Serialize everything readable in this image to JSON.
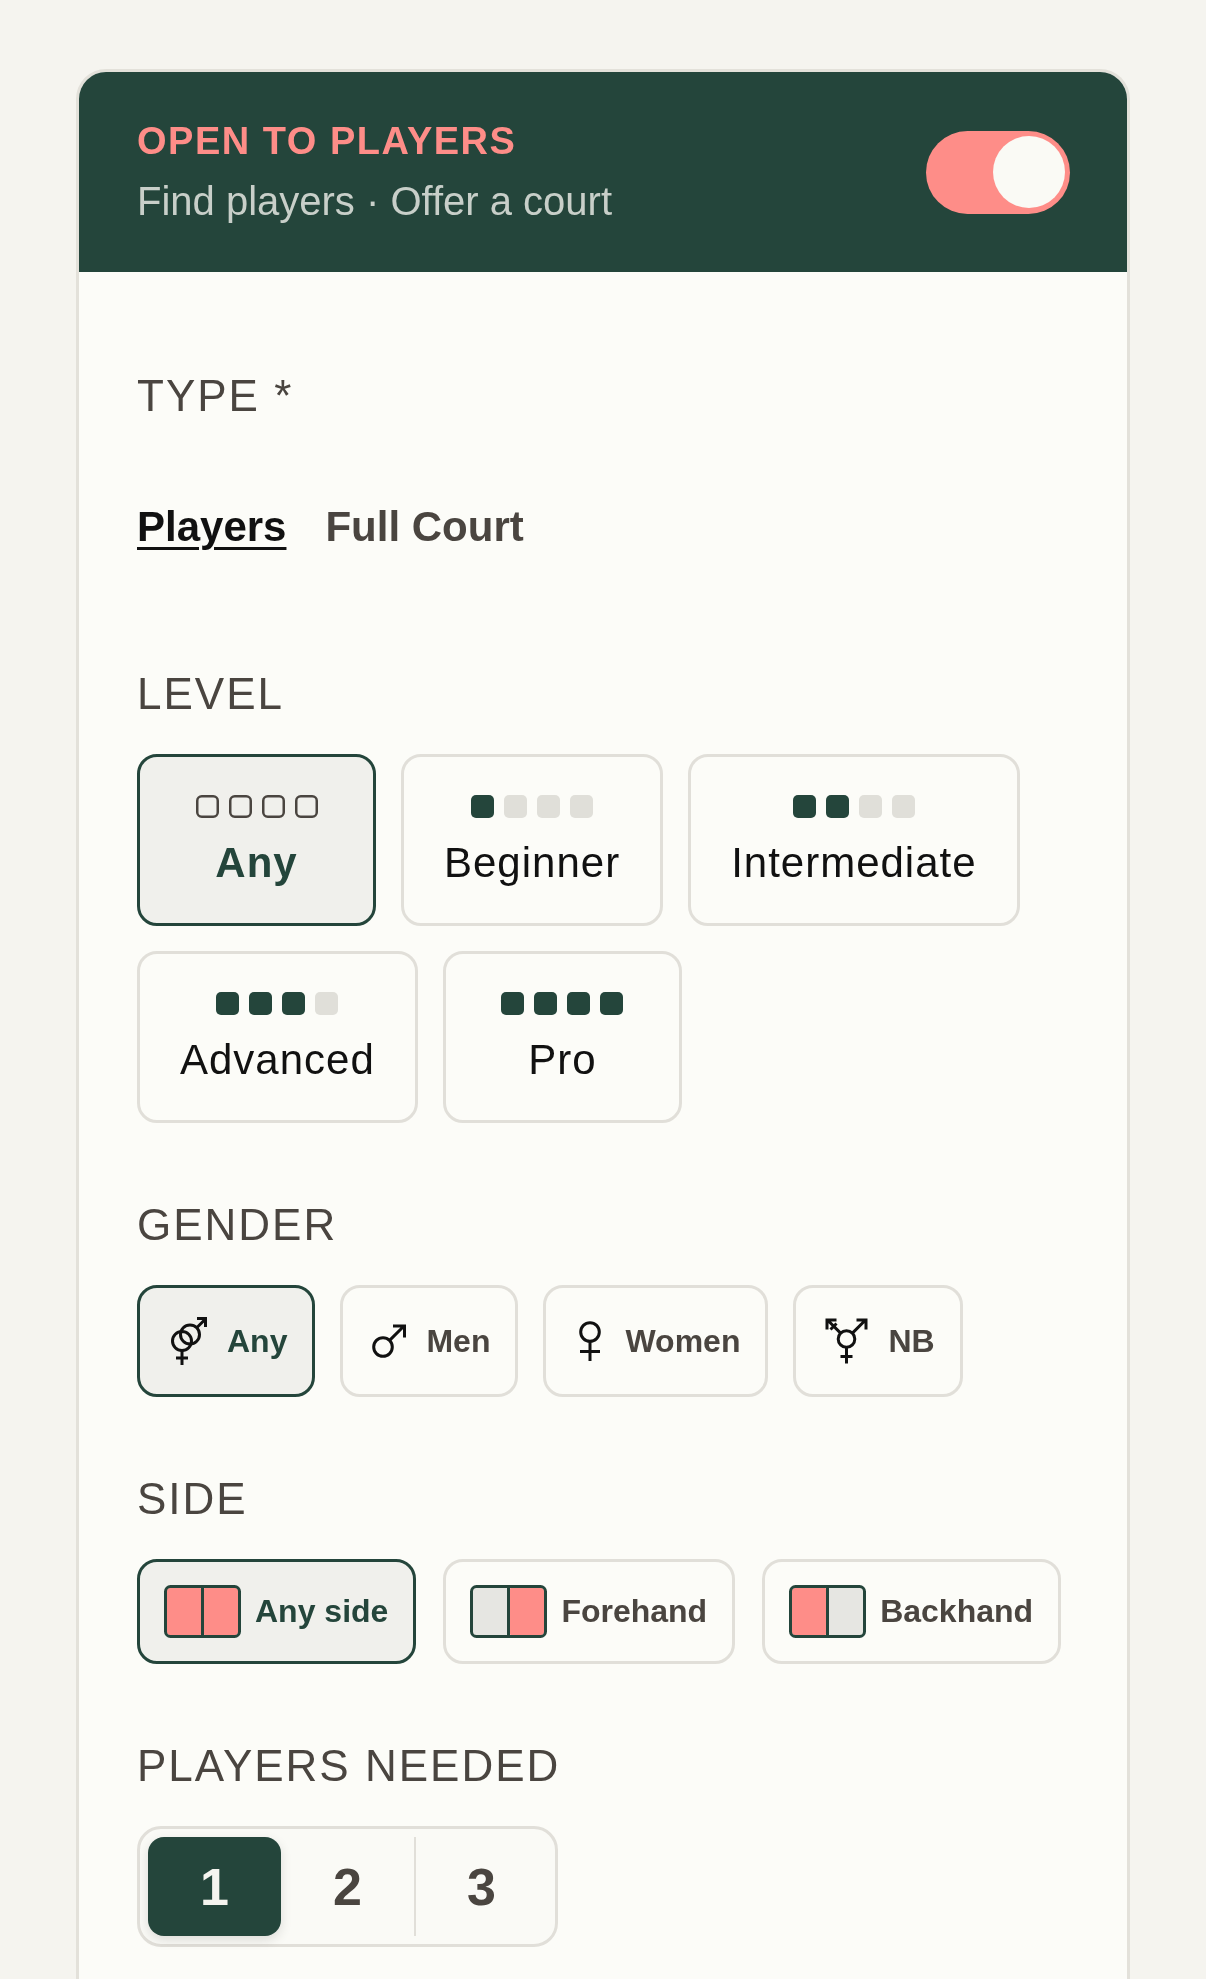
{
  "header": {
    "title": "OPEN TO PLAYERS",
    "subtitle": "Find players · Offer a court",
    "toggle": {
      "on": true
    }
  },
  "type": {
    "label": "TYPE *",
    "tabs": [
      {
        "label": "Players",
        "selected": true
      },
      {
        "label": "Full Court",
        "selected": false
      }
    ]
  },
  "level": {
    "label": "LEVEL",
    "options": [
      {
        "kind": "any",
        "label": "Any",
        "selected": true
      },
      {
        "kind": "graded",
        "label": "Beginner",
        "stars": 1,
        "selected": false
      },
      {
        "kind": "graded",
        "label": "Intermediate",
        "stars": 2,
        "selected": false
      },
      {
        "kind": "graded",
        "label": "Advanced",
        "stars": 3,
        "selected": false
      },
      {
        "kind": "graded",
        "label": "Pro",
        "stars": 4,
        "selected": false
      }
    ]
  },
  "gender": {
    "label": "GENDER",
    "options": [
      {
        "kind": "any",
        "label": "Any",
        "selected": true
      },
      {
        "kind": "men",
        "label": "Men",
        "selected": false
      },
      {
        "kind": "women",
        "label": "Women",
        "selected": false
      },
      {
        "kind": "nb",
        "label": "NB",
        "selected": false
      }
    ]
  },
  "side": {
    "label": "SIDE",
    "options": [
      {
        "kind": "any",
        "label": "Any side",
        "selected": true
      },
      {
        "kind": "forehand",
        "label": "Forehand",
        "selected": false
      },
      {
        "kind": "backhand",
        "label": "Backhand",
        "selected": false
      }
    ]
  },
  "players_needed": {
    "label": "PLAYERS NEEDED",
    "options": [
      {
        "label": "1",
        "selected": true
      },
      {
        "label": "2",
        "selected": false
      },
      {
        "label": "3",
        "selected": false
      }
    ]
  }
}
